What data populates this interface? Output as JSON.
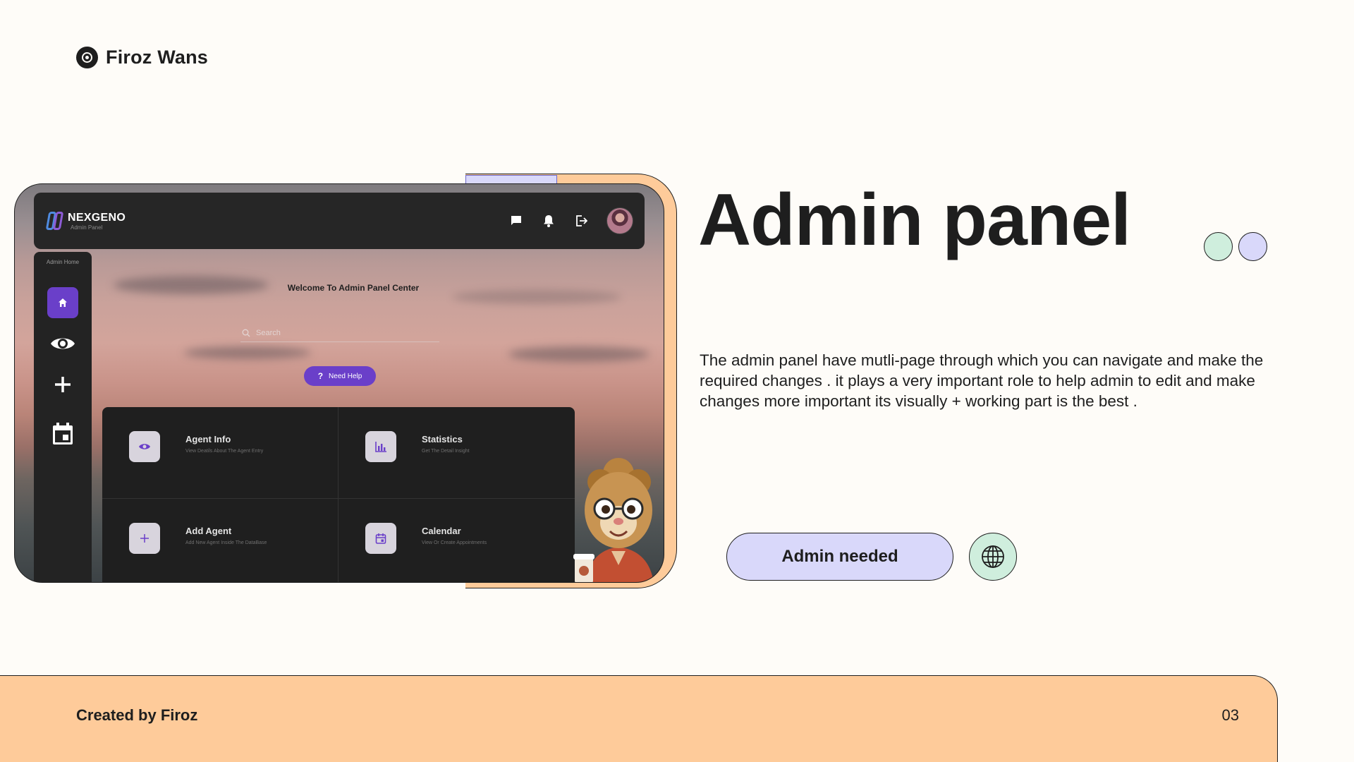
{
  "brand": {
    "name": "Firoz Wans",
    "icon": "target-icon"
  },
  "mockup": {
    "app_name": "NEXGENO",
    "app_subtitle": "Admin Panel",
    "topbar_icons": [
      "chat-icon",
      "bell-icon",
      "logout-icon"
    ],
    "sidebar": {
      "label": "Admin Home",
      "items": [
        {
          "icon": "home-icon",
          "active": true
        },
        {
          "icon": "eye-icon",
          "active": false
        },
        {
          "icon": "plus-icon",
          "active": false
        },
        {
          "icon": "calendar-icon",
          "active": false
        }
      ]
    },
    "welcome": "Welcome To Admin Panel Center",
    "search_placeholder": "Search",
    "help_label": "Need Help",
    "cards": [
      {
        "title": "Agent Info",
        "subtitle": "View Deatils About The Agent Entry",
        "icon": "eye-icon"
      },
      {
        "title": "Statistics",
        "subtitle": "Get The Detail Insight",
        "icon": "bar-chart-icon"
      },
      {
        "title": "Add Agent",
        "subtitle": "Add New Agent Inside The DataBase",
        "icon": "plus-icon"
      },
      {
        "title": "Calendar",
        "subtitle": "View Or Create Appointments",
        "icon": "calendar-icon"
      }
    ]
  },
  "headline": "Admin panel",
  "description": "The admin panel have mutli-page through which you can navigate and make the required changes . it plays a very important role to help admin to edit and make changes more important its visually + working part is the best .",
  "cta_label": "Admin needed",
  "footer": {
    "left": "Created by Firoz",
    "page_number": "03"
  },
  "colors": {
    "background": "#fefcf8",
    "accent_orange": "#fecb9a",
    "accent_purple": "#d9d8fa",
    "accent_green": "#cfeedd",
    "mockup_purple": "#6a3fc9",
    "text_dark": "#1e1e1e"
  }
}
